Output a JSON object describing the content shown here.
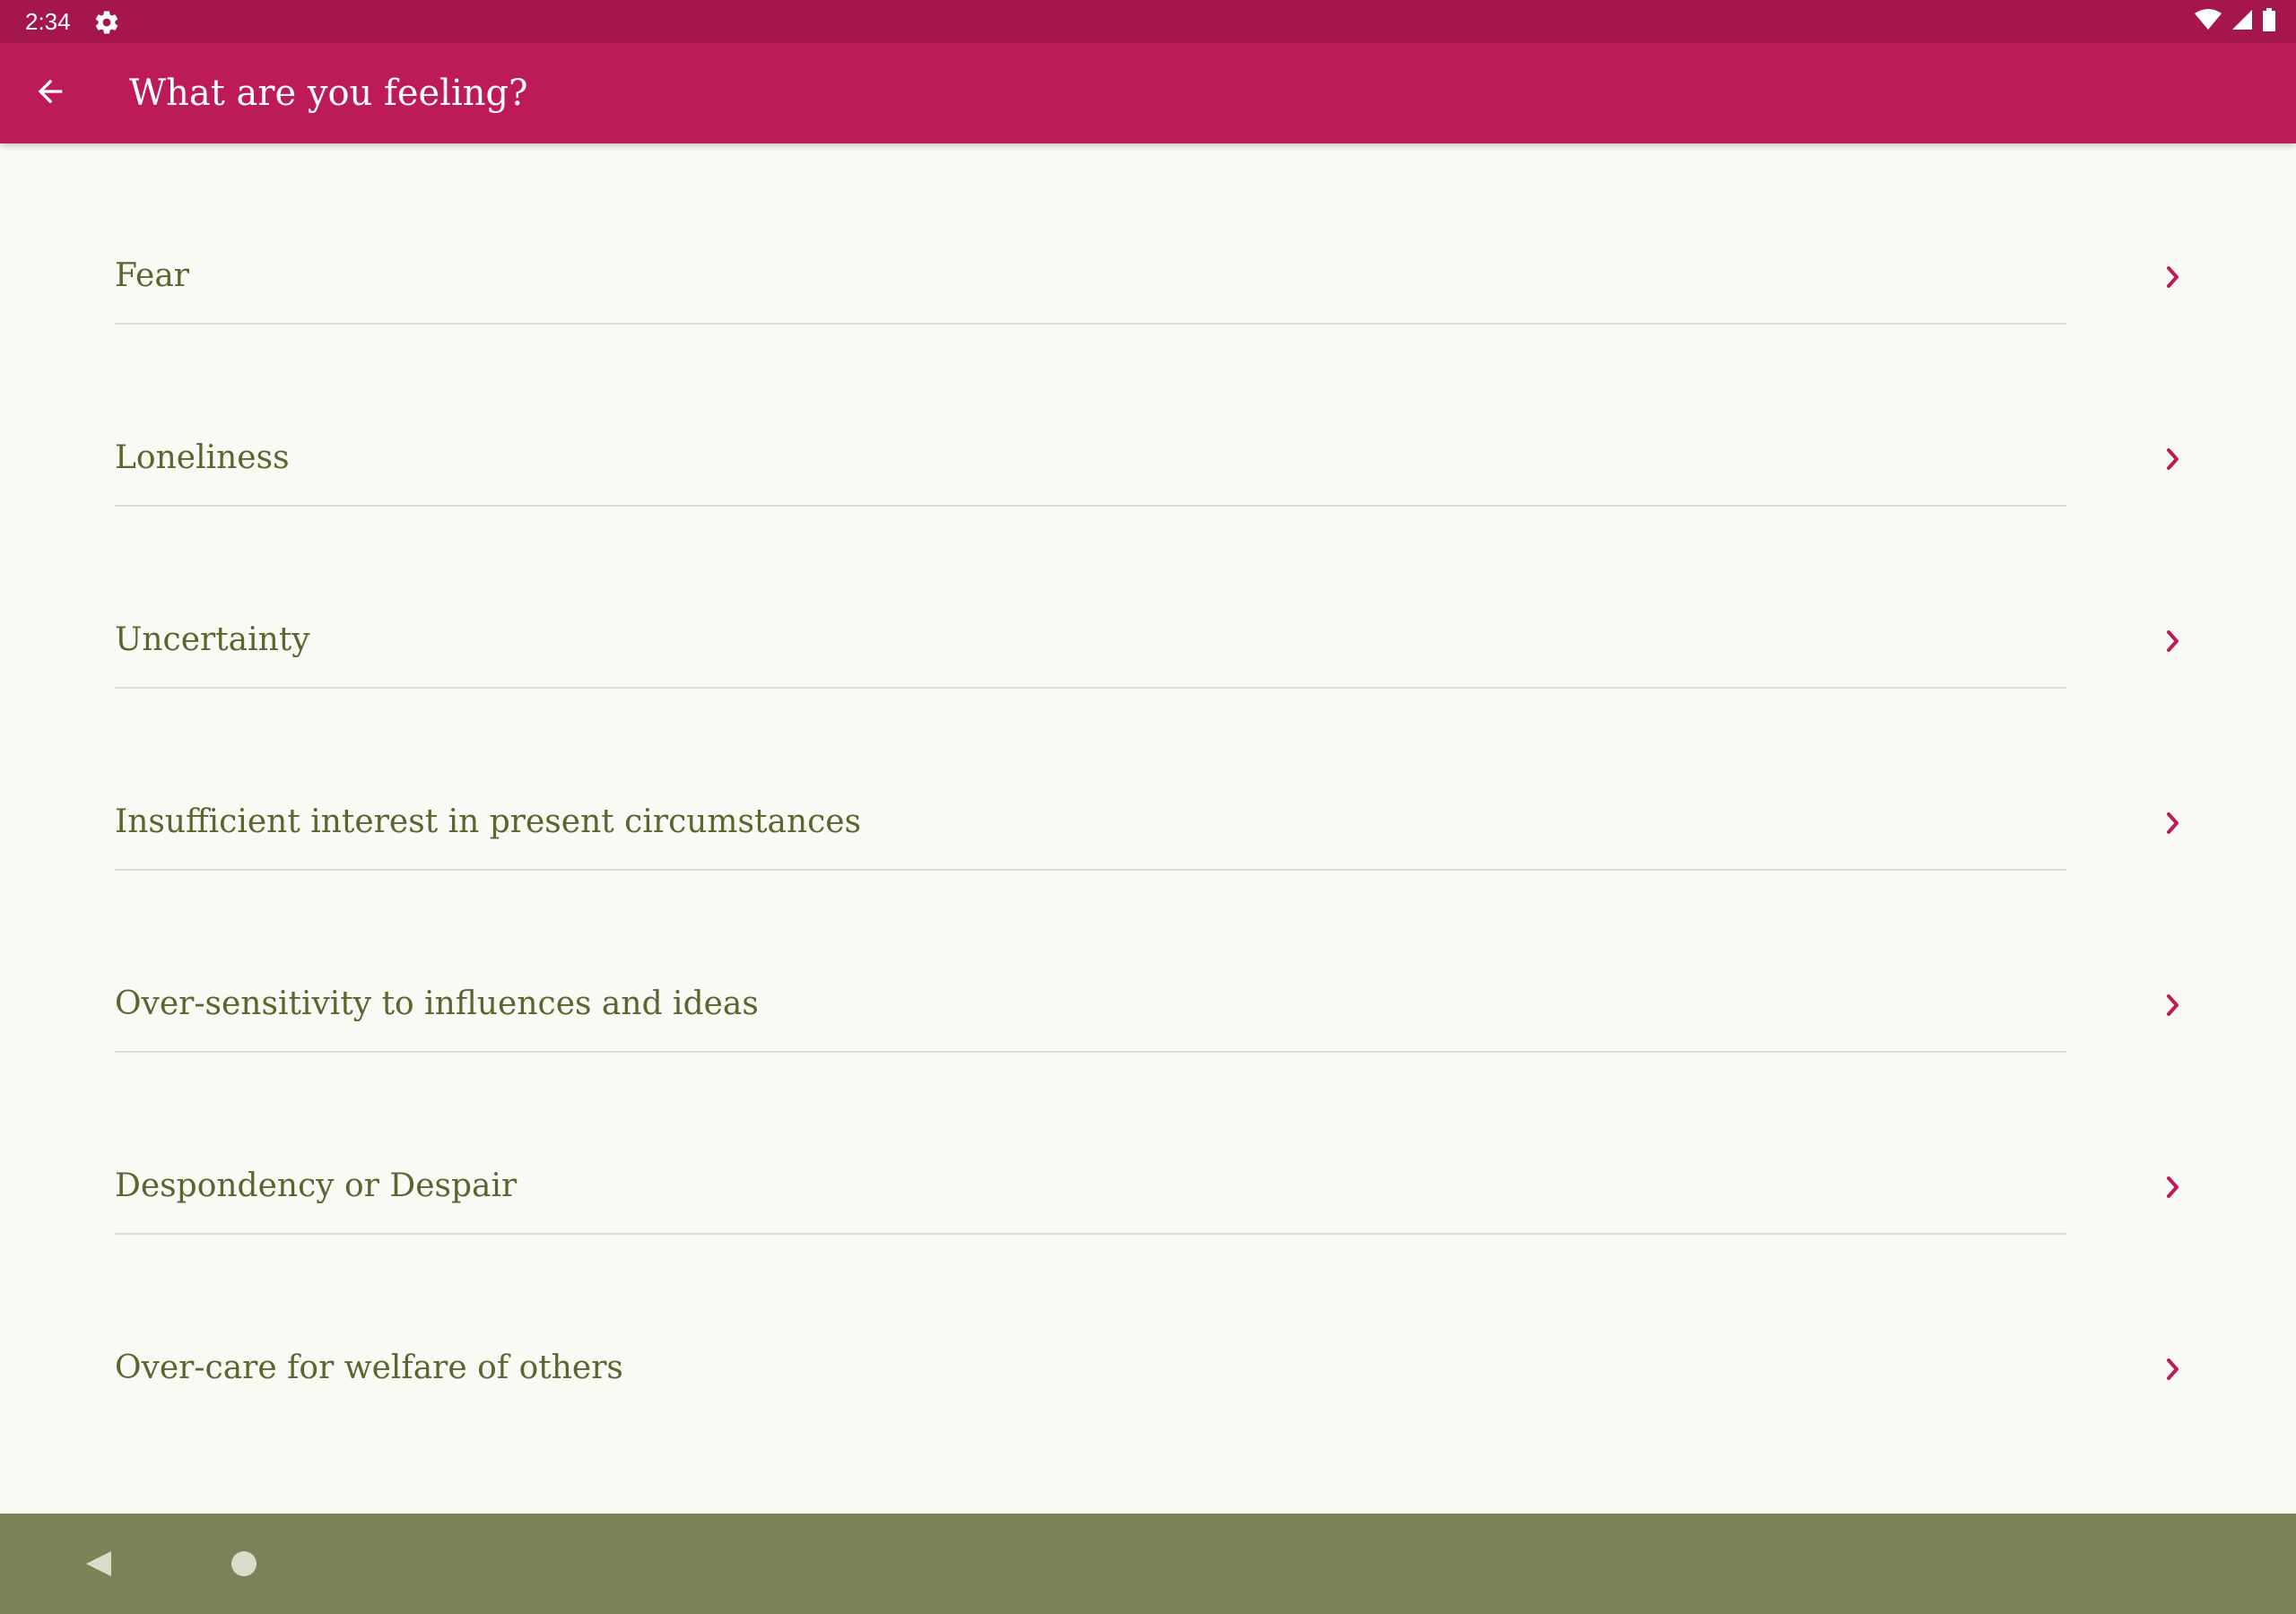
{
  "status_bar": {
    "time": "2:34",
    "icons": [
      "gear-icon",
      "wifi-icon",
      "signal-icon",
      "battery-icon"
    ]
  },
  "app_bar": {
    "title": "What are you feeling?",
    "back_icon": "arrow-back-icon"
  },
  "feelings": [
    {
      "label": "Fear"
    },
    {
      "label": "Loneliness"
    },
    {
      "label": "Uncertainty"
    },
    {
      "label": "Insufficient interest in present circumstances"
    },
    {
      "label": "Over-sensitivity to influences and ideas"
    },
    {
      "label": "Despondency or Despair"
    },
    {
      "label": "Over-care for welfare of others"
    }
  ],
  "nav_bar": {
    "icons": [
      "nav-back-icon",
      "nav-home-icon"
    ]
  },
  "colors": {
    "status_bar": "#a5174c",
    "app_bar": "#bc1b57",
    "background": "#fafaf4",
    "item_text": "#5b6530",
    "chevron": "#bc1b57",
    "divider": "#dcdcd6",
    "nav_bar": "#7b8255"
  }
}
